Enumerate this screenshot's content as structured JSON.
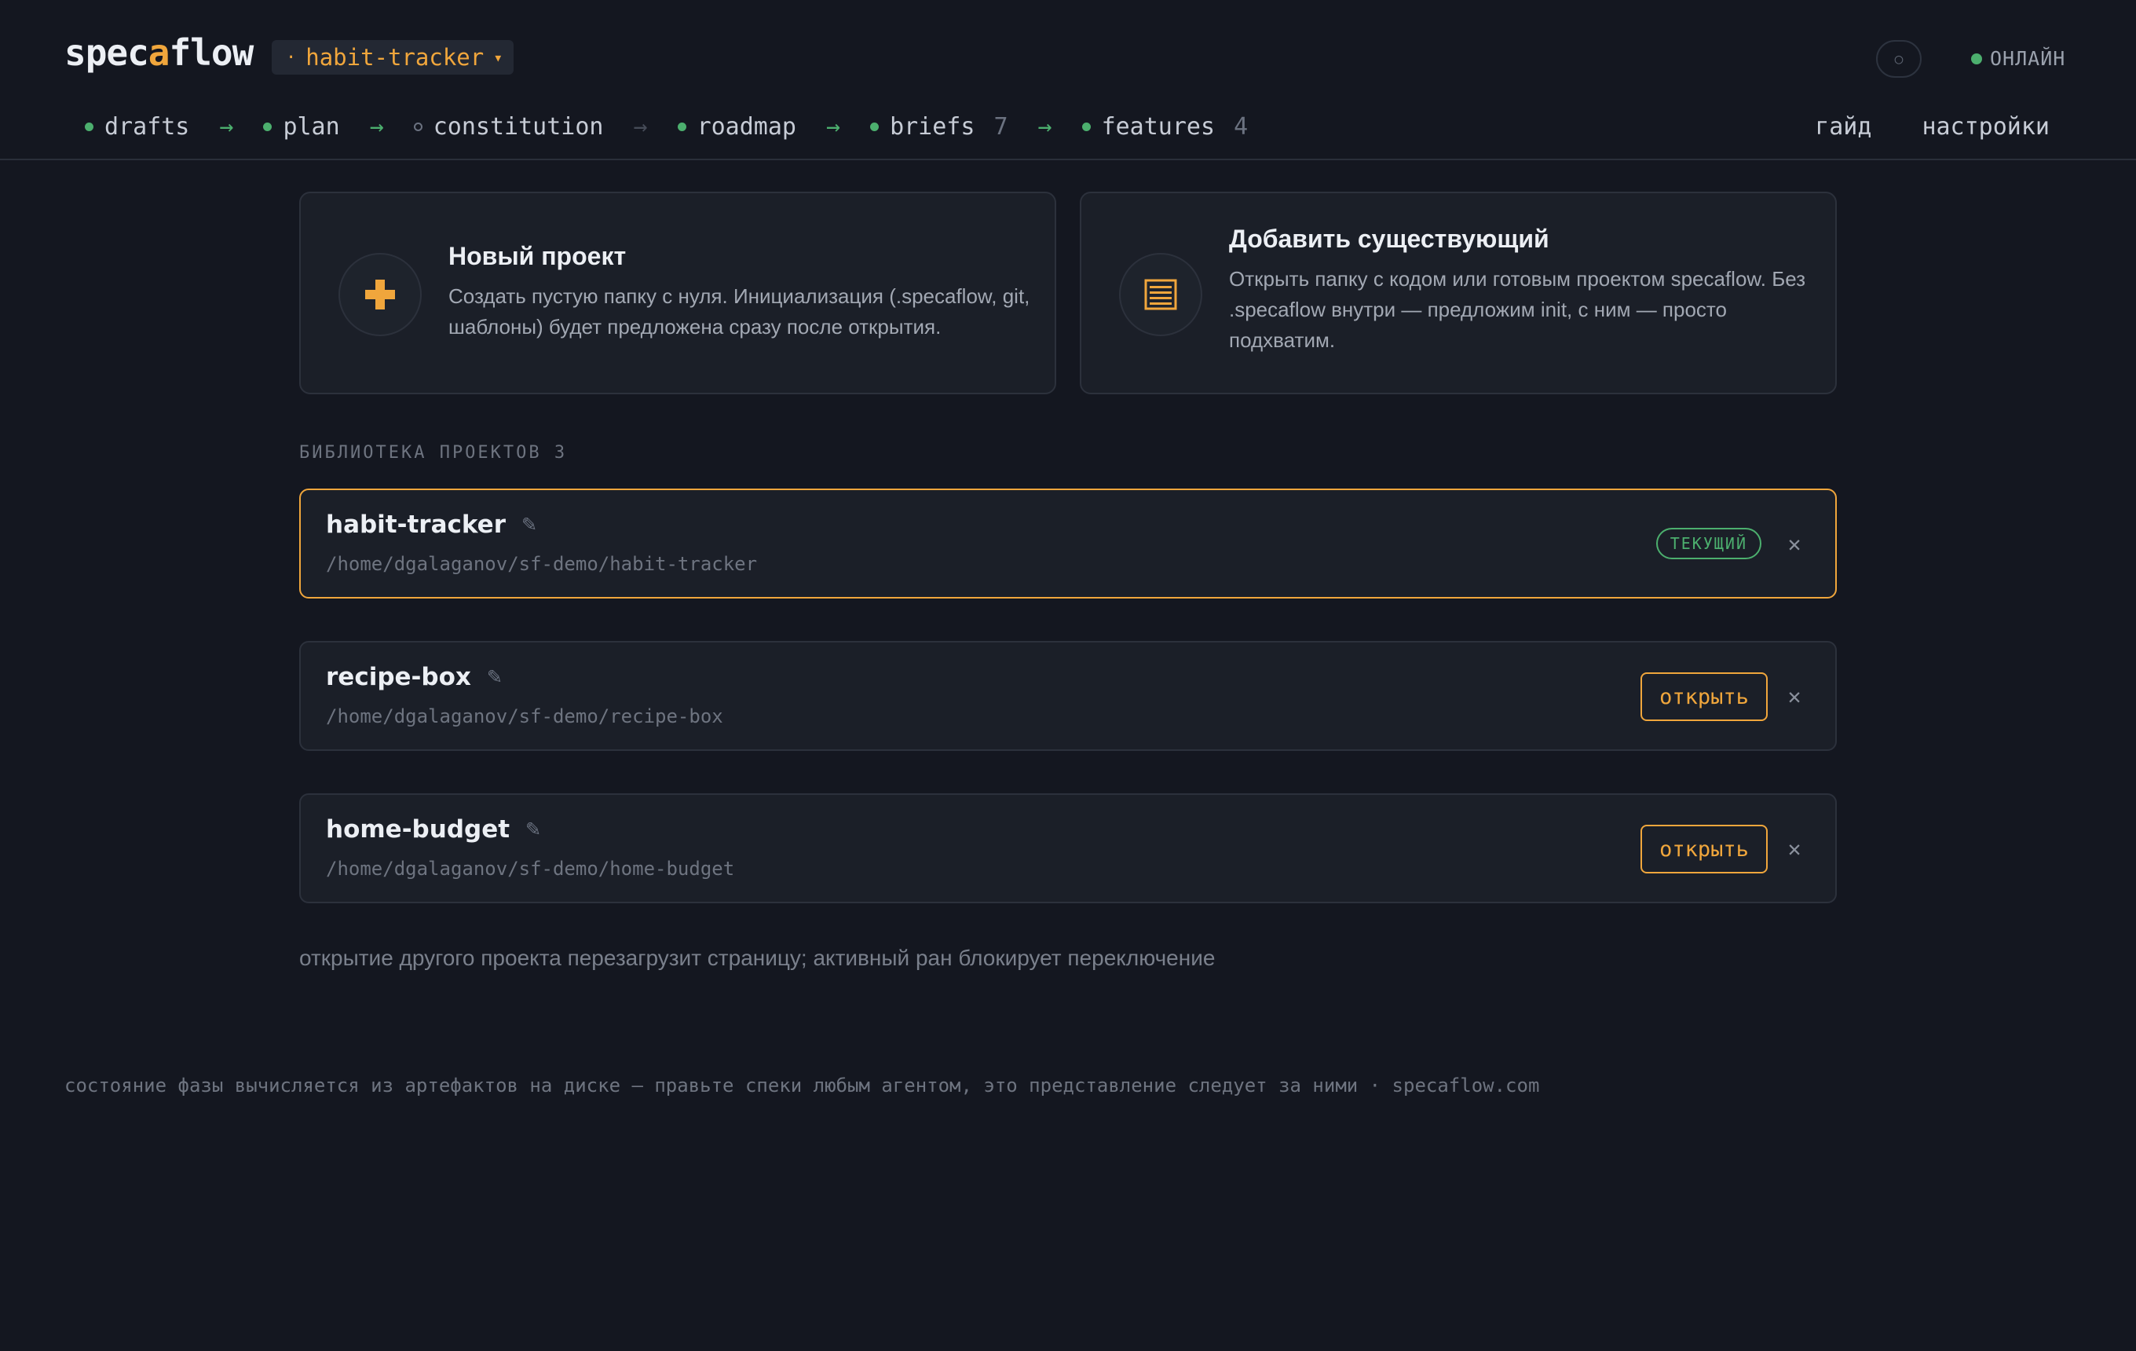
{
  "header": {
    "logo_prefix": "spec",
    "logo_accent": "a",
    "logo_suffix": "flow",
    "project_selector": {
      "dot": "·",
      "label": "habit-tracker",
      "caret": "▾"
    },
    "theme_toggle_glyph": "○",
    "status_label": "ОНЛАЙН"
  },
  "phases": [
    {
      "label": "drafts",
      "filled": true,
      "count": ""
    },
    {
      "label": "plan",
      "filled": true,
      "count": ""
    },
    {
      "label": "constitution",
      "filled": false,
      "count": ""
    },
    {
      "label": "roadmap",
      "filled": true,
      "count": ""
    },
    {
      "label": "briefs",
      "filled": true,
      "count": "7"
    },
    {
      "label": "features",
      "filled": true,
      "count": "4"
    }
  ],
  "nav": {
    "guide": "гайд",
    "settings": "настройки"
  },
  "cards": {
    "new_project": {
      "icon": "plus-icon",
      "title": "Новый проект",
      "description": "Создать пустую папку с нуля. Инициализация (.specaflow, git, шаблоны) будет предложена сразу после открытия."
    },
    "add_existing": {
      "icon": "folder-list-icon",
      "title": "Добавить существующий",
      "description": "Открыть папку с кодом или готовым проектом specaflow. Без .specaflow внутри — предложим init, с ним — просто подхватим."
    }
  },
  "library": {
    "label": "БИБЛИОТЕКА ПРОЕКТОВ",
    "count": "3",
    "projects": [
      {
        "name": "habit-tracker",
        "path": "/home/dgalaganov/sf-demo/habit-tracker",
        "current": true,
        "badge": "ТЕКУЩИЙ"
      },
      {
        "name": "recipe-box",
        "path": "/home/dgalaganov/sf-demo/recipe-box",
        "current": false,
        "open_label": "открыть"
      },
      {
        "name": "home-budget",
        "path": "/home/dgalaganov/sf-demo/home-budget",
        "current": false,
        "open_label": "открыть"
      }
    ]
  },
  "hint": "открытие другого проекта перезагрузит страницу; активный ран блокирует переключение",
  "footer": "состояние фазы вычисляется из артефактов на диске — правьте спеки любым агентом, это представление следует за ними · specaflow.com",
  "colors": {
    "accent": "#f0a63c",
    "ok": "#4caf6e",
    "background": "#141720",
    "card": "#1b1f28"
  }
}
